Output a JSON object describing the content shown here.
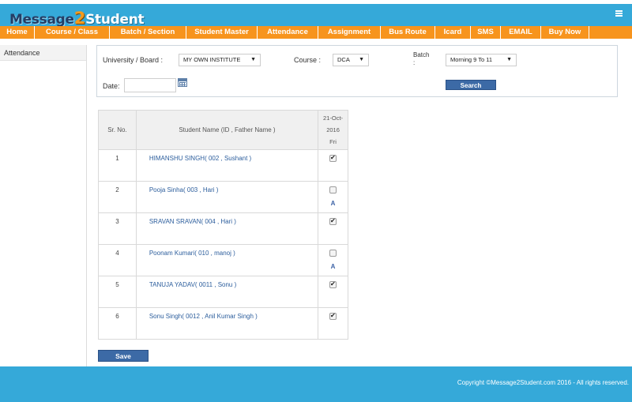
{
  "header": {
    "logo_part1": "Message",
    "logo_part2": "2",
    "logo_part3": "Student",
    "menu_icon": "hamburger-icon"
  },
  "nav": {
    "items": [
      "Home",
      "Course / Class",
      "Batch / Section",
      "Student Master",
      "Attendance",
      "Assignment",
      "Bus Route",
      "Icard",
      "SMS",
      "EMAIL",
      "Buy Now"
    ]
  },
  "sidebar": {
    "items": [
      "Attendance"
    ]
  },
  "filters": {
    "university_label": "University / Board :",
    "university_value": "MY OWN INSTITUTE",
    "course_label": "Course :",
    "course_value": "DCA",
    "batch_label_line1": "Batch",
    "batch_label_line2": ":",
    "batch_value": "Morning 9 To 11",
    "date_label": "Date:",
    "date_value": "",
    "calendar_icon": "calendar-icon",
    "search_label": "Search"
  },
  "table": {
    "col_sr": "Sr. No.",
    "col_name": "Student Name (ID , Father Name )",
    "col_date_line1": "21-Oct-",
    "col_date_line2": "2016",
    "col_date_line3": "Fri",
    "rows": [
      {
        "sr": "1",
        "name": "HIMANSHU SINGH( 002 , Sushant )",
        "present": true,
        "mark": ""
      },
      {
        "sr": "2",
        "name": "Pooja Sinha( 003 , Hari )",
        "present": false,
        "mark": "A"
      },
      {
        "sr": "3",
        "name": "SRAVAN SRAVAN( 004 , Hari )",
        "present": true,
        "mark": ""
      },
      {
        "sr": "4",
        "name": "Poonam Kumari( 010 , manoj )",
        "present": false,
        "mark": "A"
      },
      {
        "sr": "5",
        "name": "TANUJA YADAV( 0011 , Sonu )",
        "present": true,
        "mark": ""
      },
      {
        "sr": "6",
        "name": "Sonu Singh( 0012 , Anil Kumar Singh )",
        "present": true,
        "mark": ""
      }
    ]
  },
  "save_label": "Save",
  "footer": {
    "copyright": "Copyright ©Message2Student.com 2016 - All rights reserved."
  },
  "colors": {
    "header_blue": "#35a9d9",
    "nav_orange": "#f7941d",
    "button_blue": "#3c6aa6"
  }
}
